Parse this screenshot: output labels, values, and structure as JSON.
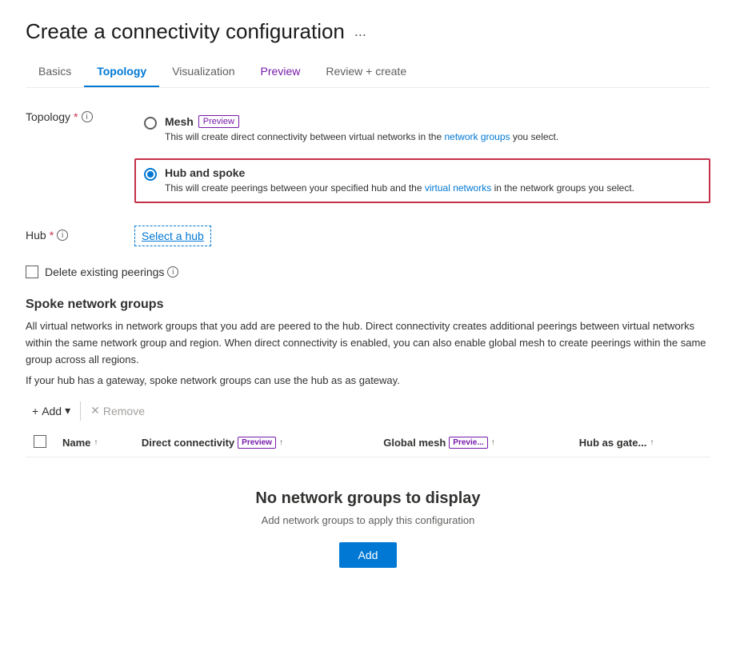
{
  "page": {
    "title": "Create a connectivity configuration",
    "ellipsis": "..."
  },
  "tabs": [
    {
      "id": "basics",
      "label": "Basics",
      "active": false,
      "preview": false
    },
    {
      "id": "topology",
      "label": "Topology",
      "active": true,
      "preview": false
    },
    {
      "id": "visualization",
      "label": "Visualization",
      "active": false,
      "preview": false
    },
    {
      "id": "preview",
      "label": "Preview",
      "active": false,
      "preview": true
    },
    {
      "id": "review",
      "label": "Review + create",
      "active": false,
      "preview": false
    }
  ],
  "topology_field": {
    "label": "Topology",
    "options": [
      {
        "id": "mesh",
        "label": "Mesh",
        "preview": true,
        "preview_label": "Preview",
        "description": "This will create direct connectivity between virtual networks in the network groups you select.",
        "selected": false
      },
      {
        "id": "hub_spoke",
        "label": "Hub and spoke",
        "preview": false,
        "description": "This will create peerings between your specified hub and the virtual networks in the network groups you select.",
        "selected": true
      }
    ]
  },
  "hub_field": {
    "label": "Hub",
    "select_link": "Select a hub"
  },
  "delete_peerings": {
    "label": "Delete existing peerings"
  },
  "spoke_section": {
    "title": "Spoke network groups",
    "desc1": "All virtual networks in network groups that you add are peered to the hub. Direct connectivity creates additional peerings between virtual networks within the same network group and region. When direct connectivity is enabled, you can also enable global mesh to create peerings within the same group across all regions.",
    "desc2": "If your hub has a gateway, spoke network groups can use the hub as as gateway."
  },
  "toolbar": {
    "add_label": "Add",
    "add_chevron": "▾",
    "remove_label": "Remove"
  },
  "table": {
    "columns": [
      {
        "id": "name",
        "label": "Name",
        "sort": "↑"
      },
      {
        "id": "direct_connectivity",
        "label": "Direct connectivity",
        "preview_label": "Preview",
        "sort": "↑"
      },
      {
        "id": "global_mesh",
        "label": "Global mesh",
        "preview_label": "Previe...",
        "sort": "↑"
      },
      {
        "id": "hub_as_gate",
        "label": "Hub as gate...",
        "sort": "↑"
      }
    ],
    "rows": []
  },
  "empty_state": {
    "title": "No network groups to display",
    "description": "Add network groups to apply this configuration",
    "add_button": "Add"
  }
}
